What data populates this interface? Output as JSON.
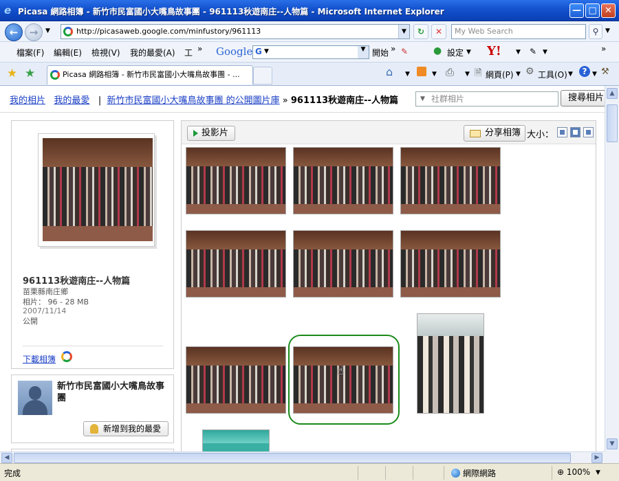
{
  "window": {
    "title": "Picasa 網路相簿 - 新竹市民富國小大嘴鳥故事團 - 961113秋遊南庄--人物篇 - Microsoft Internet Explorer",
    "min": "—",
    "max": "□",
    "close": "✕"
  },
  "address": {
    "url": "http://picasaweb.google.com/minfustory/961113",
    "search_placeholder": "My Web Search",
    "back_icon": "back-arrow-icon",
    "forward_icon": "forward-arrow-icon"
  },
  "menu": {
    "items": [
      "檔案(F)",
      "編輯(E)",
      "檢視(V)",
      "我的最愛(A)",
      "工"
    ],
    "google_label": "Google",
    "google_box": "G",
    "go_label": "開始",
    "settings_label": "設定",
    "yahoo_label": "Y!"
  },
  "tabs": {
    "active_title": "Picasa 網路相簿 - 新竹市民富國小大嘴鳥故事團 - ...",
    "page_label": "網頁(P)",
    "tools_label": "工具(O)"
  },
  "breadcrumb": {
    "my_photos": "我的相片",
    "my_favorites": "我的最愛",
    "separator": "|",
    "gallery_link": "新竹市民富國小大嘴鳥故事團 的公開圖片庫",
    "arrow": "»",
    "current": "961113秋遊南庄--人物篇"
  },
  "search": {
    "community_placeholder": "社群相片",
    "button_label": "搜尋相片"
  },
  "album": {
    "title": "961113秋遊南庄--人物篇",
    "location": "苗栗縣南庄鄉",
    "photos_line": "相片： 96 - 28 MB",
    "date": "2007/11/14",
    "visibility": "公開",
    "download_label": "下載相簿"
  },
  "owner": {
    "name": "新竹市民富國小大嘴鳥故事團",
    "add_favorite_label": "新增到我的最愛"
  },
  "toolbar": {
    "slideshow_label": "投影片",
    "share_label": "分享相簿",
    "size_label": "大小："
  },
  "status": {
    "text": "完成",
    "zone": "網際網路",
    "zoom": "100%"
  },
  "colors": {
    "link": "#1a3fc4",
    "highlight_ring": "#1a8a1a",
    "titlebar": "#1554d0"
  }
}
